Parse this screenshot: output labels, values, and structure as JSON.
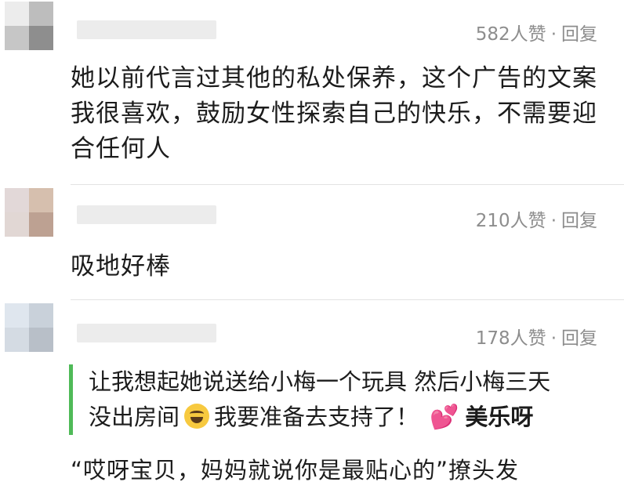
{
  "comments": [
    {
      "likes": "582人赞",
      "reply": "回复",
      "text": "她以前代言过其他的私处保养，这个广告的文案我很喜欢，鼓励女性探索自己的快乐，不需要迎合任何人"
    },
    {
      "likes": "210人赞",
      "reply": "回复",
      "text": "吸地好棒"
    },
    {
      "likes": "178人赞",
      "reply": "回复",
      "quote_line1": "让我想起她说送给小梅一个玩具 然后小梅三天",
      "quote_line2a": "没出房间",
      "quote_line2b": "我要准备去支持了！",
      "quote_signature": "美乐呀",
      "emoji_icon": "laughing-tears-emoji",
      "heart_icon": "two-hearts-emoji",
      "heart_glyph": "💕",
      "text": "“哎呀宝贝，妈妈就说你是最贴心的”撩头发"
    }
  ],
  "dot": "·"
}
